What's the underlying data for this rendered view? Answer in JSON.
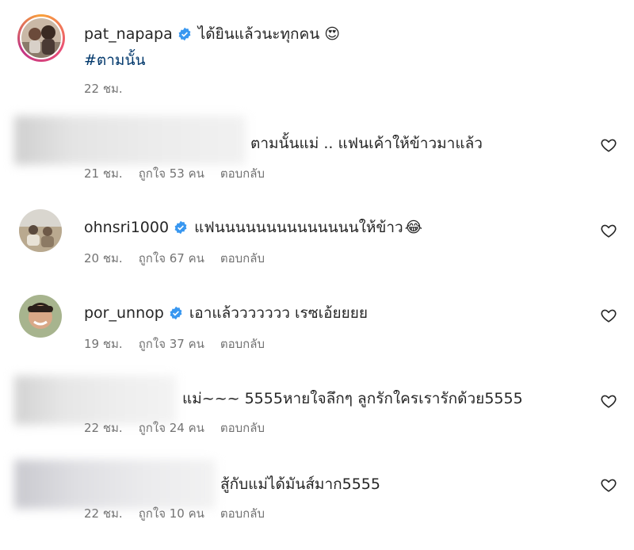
{
  "post": {
    "username": "pat_napapa",
    "caption": "ได้ยินแล้วนะทุกคน",
    "caption_emoji": "😍",
    "hashtag": "#ตามนั้น",
    "time": "22 ชม."
  },
  "comments": [
    {
      "username": "",
      "text": "ตามนั้นแม่ .. แฟนเค้าให้ข้าวมาแล้ว",
      "time": "21 ชม.",
      "likes": "ถูกใจ 53 คน",
      "reply": "ตอบกลับ"
    },
    {
      "username": "ohnsri1000",
      "text": "แฟนนนนนนนนนนนนนนให้ข้าว",
      "emoji": "😂",
      "time": "20 ชม.",
      "likes": "ถูกใจ 67 คน",
      "reply": "ตอบกลับ"
    },
    {
      "username": "por_unnop",
      "text": "เอาแล้ววววววว เรซเอ้ยยยย",
      "time": "19 ชม.",
      "likes": "ถูกใจ 37 คน",
      "reply": "ตอบกลับ"
    },
    {
      "username": "",
      "text": "แม่~~~ 5555หายใจลึกๆ ลูกรักใครเรารักด้วย5555",
      "time": "22 ชม.",
      "likes": "ถูกใจ 24 คน",
      "reply": "ตอบกลับ"
    },
    {
      "username": "",
      "text": "สู้กับแม่ได้มันส์มาก5555",
      "time": "22 ชม.",
      "likes": "ถูกใจ 10 คน",
      "reply": "ตอบกลับ"
    }
  ],
  "icons": {
    "like": "heart-outline-icon",
    "verified": "verified-badge-icon"
  },
  "colors": {
    "verified": "#3897f0",
    "hashtag": "#00376b",
    "meta": "#737373"
  }
}
